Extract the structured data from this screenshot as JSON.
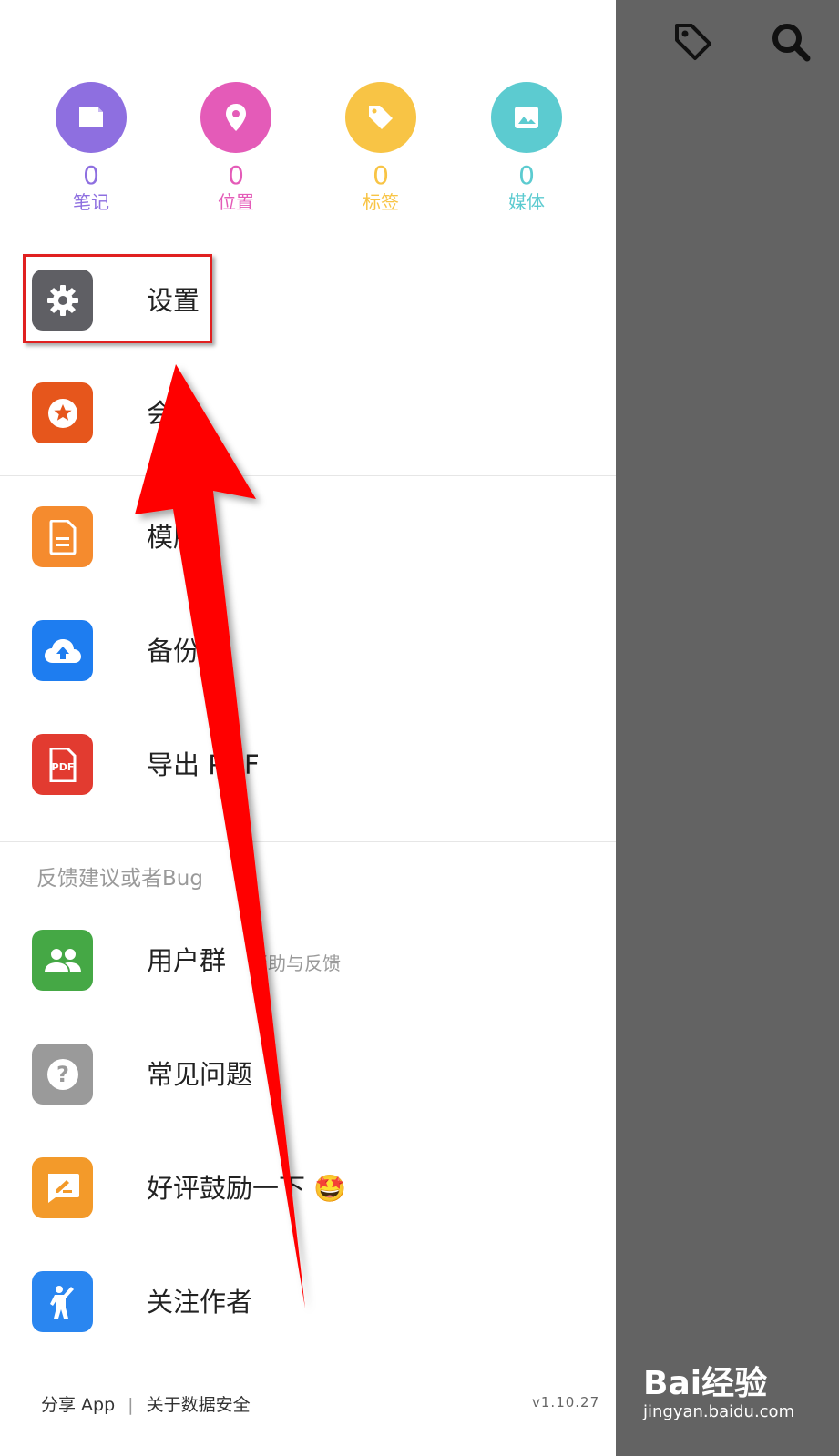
{
  "stats": [
    {
      "count": "0",
      "label": "笔记",
      "color": "#8E6FE0",
      "icon": "note-icon"
    },
    {
      "count": "0",
      "label": "位置",
      "color": "#E45BB8",
      "icon": "location-pin-icon"
    },
    {
      "count": "0",
      "label": "标签",
      "color": "#F8C445",
      "icon": "tag-icon"
    },
    {
      "count": "0",
      "label": "媒体",
      "color": "#5CCBD0",
      "icon": "image-icon"
    }
  ],
  "menu_group_1": [
    {
      "label": "设置",
      "icon": "gear-icon",
      "color": "#5F5F64"
    },
    {
      "label": "会",
      "icon": "star-badge-icon",
      "color": "#E6561C"
    }
  ],
  "menu_group_2": [
    {
      "label": "模版",
      "icon": "document-icon",
      "color": "#F58B2E"
    },
    {
      "label": "备份",
      "icon": "cloud-upload-icon",
      "color": "#1E7DF0"
    },
    {
      "label": "导出 PDF",
      "icon": "pdf-icon",
      "color": "#E23B30"
    }
  ],
  "feedback": {
    "title": "反馈建议或者Bug",
    "items": [
      {
        "label": "用户群",
        "sub": "帮助与反馈",
        "icon": "users-icon",
        "color": "#45A845"
      },
      {
        "label": "常见问题",
        "sub": "",
        "icon": "question-icon",
        "color": "#9A9A9A"
      },
      {
        "label": "好评鼓励一下 🤩",
        "sub": "",
        "icon": "rate-edit-icon",
        "color": "#F39A2A"
      },
      {
        "label": "关注作者",
        "sub": "",
        "icon": "person-waving-icon",
        "color": "#2A86F0"
      }
    ]
  },
  "footer": {
    "share": "分享 App",
    "separator": "|",
    "security": "关于数据安全",
    "version": "v1.10.27"
  },
  "watermark": {
    "logo": "Bai经验",
    "site": "jingyan.baidu.com"
  }
}
